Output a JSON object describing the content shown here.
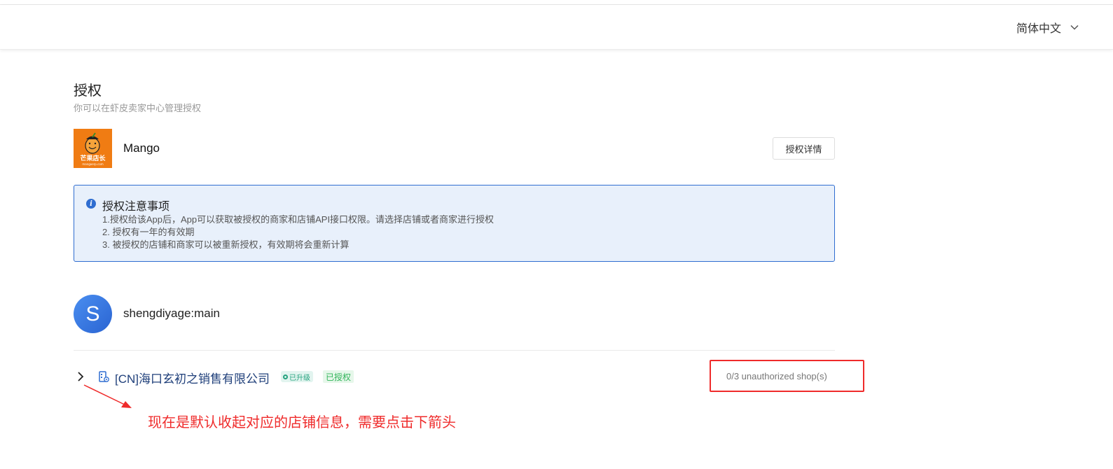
{
  "header": {
    "language_label": "简体中文",
    "language_icon": "chevron-down-icon"
  },
  "page": {
    "title": "授权",
    "subtitle": "你可以在虾皮卖家中心管理授权"
  },
  "app": {
    "name": "Mango",
    "logo_text": "芒果店长",
    "logo_subtext": "mangoerp.com",
    "auth_detail_button": "授权详情"
  },
  "notice": {
    "icon": "info-icon",
    "title": "授权注意事项",
    "items": [
      "1.授权给该App后，App可以获取被授权的商家和店铺API接口权限。请选择店铺或者商家进行授权",
      "2. 授权有一年的有效期",
      "3. 被授权的店铺和商家可以被重新授权，有效期将会重新计算"
    ]
  },
  "merchant": {
    "avatar_letter": "S",
    "name": "shengdiyage:main"
  },
  "company": {
    "name": "[CN]海口玄初之销售有限公司",
    "badge_upgraded": "已升级",
    "badge_authorized": "已授权",
    "unauthorized_shops": "0/3 unauthorized shop(s)"
  },
  "annotation": {
    "text": "现在是默认收起对应的店铺信息，需要点击下箭头"
  },
  "colors": {
    "primary": "#2f6dd0",
    "notice_bg": "#e8f0fb",
    "annotation_red": "#ef2b2b",
    "logo_orange": "#f07c13",
    "badge_green": "#26a37f"
  }
}
